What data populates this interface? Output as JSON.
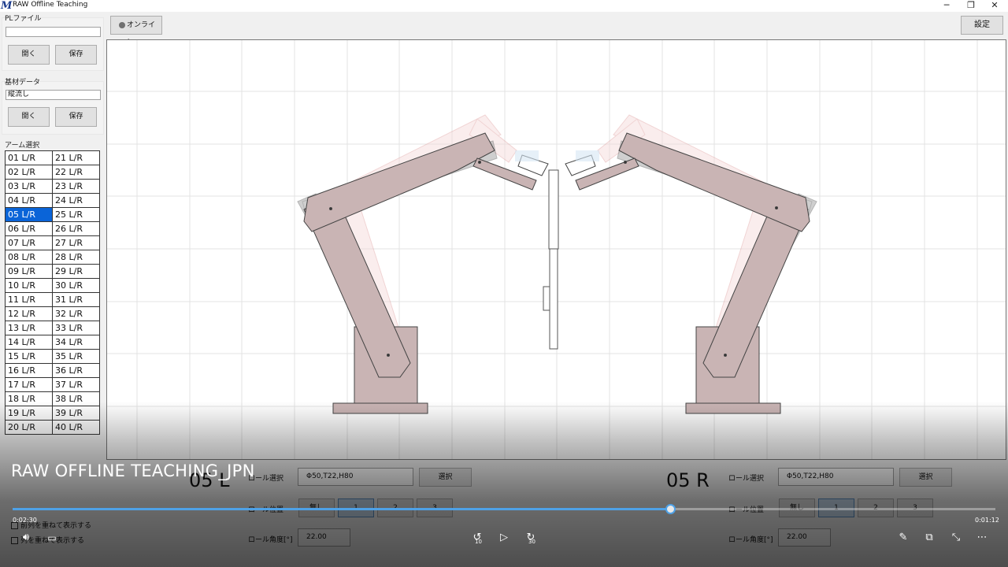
{
  "window": {
    "title": "RAW Offline Teaching",
    "logo": "M"
  },
  "left_panel": {
    "pl_file": {
      "label": "PLファイル",
      "value": "",
      "open_label": "開く",
      "save_label": "保存"
    },
    "substrate": {
      "label": "基材データ",
      "value": "縦流し",
      "open_label": "開く",
      "save_label": "保存"
    },
    "arm_select_label": "アーム選択",
    "arms_left": [
      "01 L/R",
      "02 L/R",
      "03 L/R",
      "04 L/R",
      "05 L/R",
      "06 L/R",
      "07 L/R",
      "08 L/R",
      "09 L/R",
      "10 L/R",
      "11 L/R",
      "12 L/R",
      "13 L/R",
      "14 L/R",
      "15 L/R",
      "16 L/R",
      "17 L/R",
      "18 L/R",
      "19 L/R",
      "20 L/R"
    ],
    "arms_right": [
      "21 L/R",
      "22 L/R",
      "23 L/R",
      "24 L/R",
      "25 L/R",
      "26 L/R",
      "27 L/R",
      "28 L/R",
      "29 L/R",
      "30 L/R",
      "31 L/R",
      "32 L/R",
      "33 L/R",
      "34 L/R",
      "35 L/R",
      "36 L/R",
      "37 L/R",
      "38 L/R",
      "39 L/R",
      "40 L/R"
    ],
    "selected_arm": "05 L/R",
    "checkbox1": "前列を重ねて表示する",
    "checkbox2": "列を重ねて表示する"
  },
  "top": {
    "online_label": "オンライン",
    "settings_label": "設定"
  },
  "left_arm": {
    "name": "05 L",
    "roll_select_label": "ロール選択",
    "roll_select_value": "Φ50,T22,H80",
    "select_button": "選択",
    "roll_position_label": "ロール位置",
    "positions": [
      "無し",
      "1",
      "2",
      "3"
    ],
    "active_position": "1",
    "roll_angle_label": "ロール角度[°]",
    "roll_angle_value": "22.00"
  },
  "right_arm": {
    "name": "05 R",
    "roll_select_label": "ロール選択",
    "roll_select_value": "Φ50,T22,H80",
    "select_button": "選択",
    "roll_position_label": "ロール位置",
    "positions": [
      "無し",
      "1",
      "2",
      "3"
    ],
    "active_position": "1",
    "roll_angle_label": "ロール角度[°]",
    "roll_angle_value": "22.00"
  },
  "video": {
    "title": "RAW OFFLINE TEACHING_JPN",
    "current_time": "0:02:30",
    "remaining_time": "0:01:12",
    "progress": 0.67,
    "skip_back": "10",
    "skip_forward": "30"
  },
  "colors": {
    "selection": "#0a64d8",
    "arm_body": "#c9b4b4",
    "arm_gray": "#a8a8a8",
    "progress": "#4ea1e6"
  }
}
